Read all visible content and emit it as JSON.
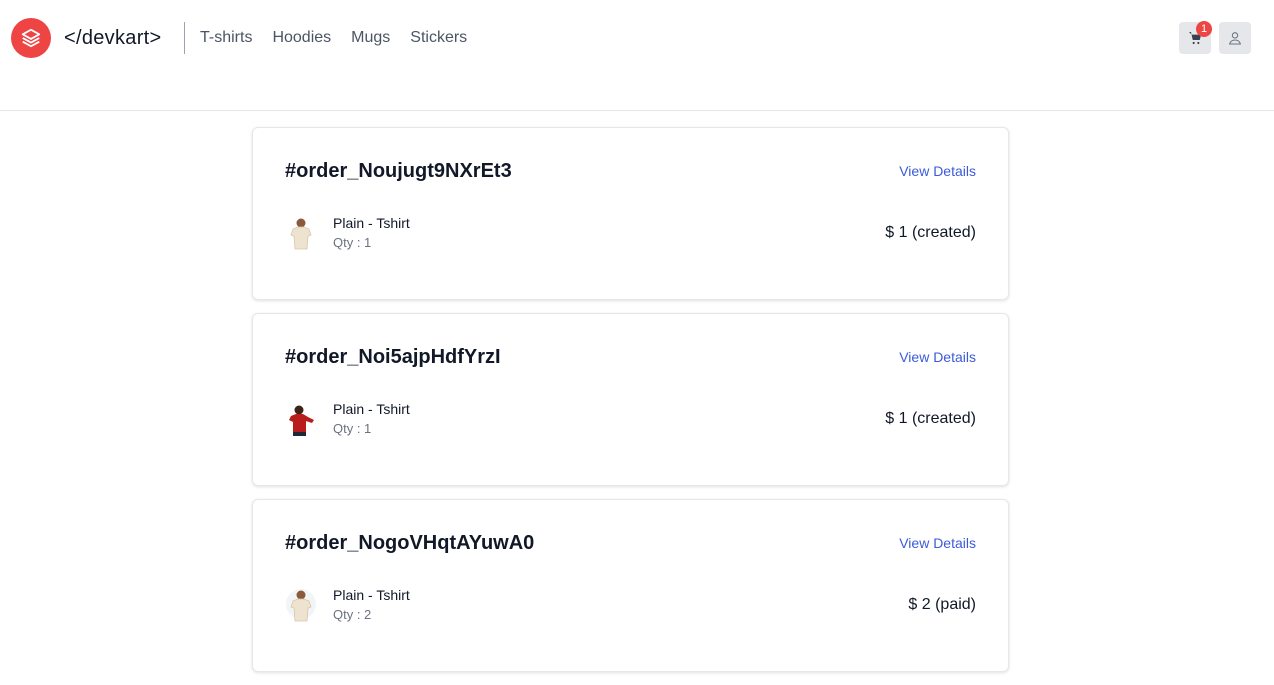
{
  "brand": {
    "name": "</devkart>",
    "logo_icon": "layers-icon",
    "logo_color": "#ef4444"
  },
  "nav": {
    "items": [
      "T-shirts",
      "Hoodies",
      "Mugs",
      "Stickers"
    ]
  },
  "header_actions": {
    "cart_icon": "cart-icon",
    "cart_count": "1",
    "user_icon": "user-icon"
  },
  "orders": [
    {
      "id": "#order_Noujugt9NXrEt3",
      "view_label": "View Details",
      "item": {
        "name": "Plain - Tshirt",
        "qty": "Qty : 1",
        "color": "#f0e6d2"
      },
      "price": "$ 1 (created)"
    },
    {
      "id": "#order_Noi5ajpHdfYrzI",
      "view_label": "View Details",
      "item": {
        "name": "Plain - Tshirt",
        "qty": "Qty : 1",
        "color": "#b91c1c"
      },
      "price": "$ 1 (created)"
    },
    {
      "id": "#order_NogoVHqtAYuwA0",
      "view_label": "View Details",
      "item": {
        "name": "Plain - Tshirt",
        "qty": "Qty : 2",
        "color": "#f0e6d2"
      },
      "price": "$ 2 (paid)"
    }
  ]
}
